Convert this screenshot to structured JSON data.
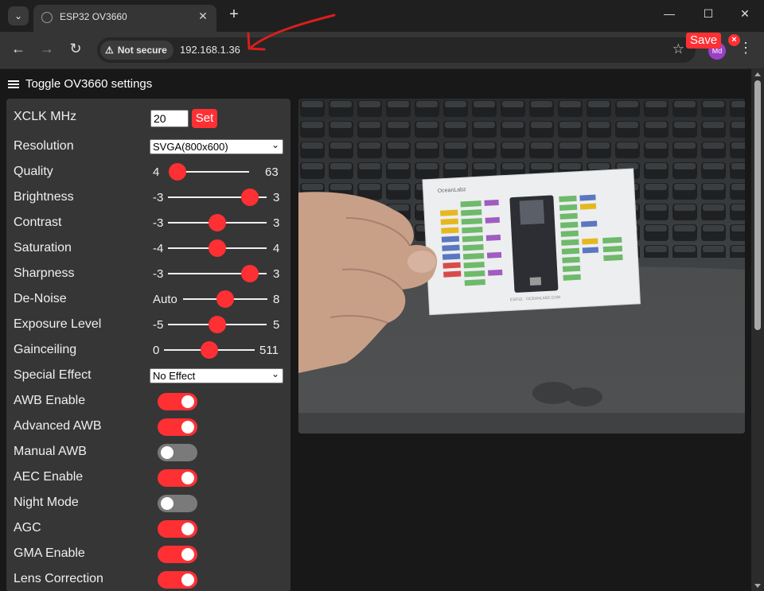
{
  "browser": {
    "tab_title": "ESP32 OV3660",
    "tab_close": "✕",
    "new_tab": "+",
    "security_label": "Not secure",
    "url": "192.168.1.36",
    "profile_initials": "Md"
  },
  "page": {
    "toggle_label": "Toggle OV3660 settings",
    "xclk": {
      "label": "XCLK MHz",
      "value": "20",
      "button": "Set"
    },
    "resolution": {
      "label": "Resolution",
      "selected": "SVGA(800x600)"
    },
    "special_effect": {
      "label": "Special Effect",
      "selected": "No Effect"
    },
    "sliders": [
      {
        "label": "Quality",
        "min": "4",
        "max": "63",
        "value": 10
      },
      {
        "label": "Brightness",
        "min": "-3",
        "max": "3",
        "value": 2
      },
      {
        "label": "Contrast",
        "min": "-3",
        "max": "3",
        "value": 0
      },
      {
        "label": "Saturation",
        "min": "-4",
        "max": "4",
        "value": 0
      },
      {
        "label": "Sharpness",
        "min": "-3",
        "max": "3",
        "value": 2
      },
      {
        "label": "De-Noise",
        "min": "Auto",
        "max": "8",
        "value": 4
      },
      {
        "label": "Exposure Level",
        "min": "-5",
        "max": "5",
        "value": 0
      },
      {
        "label": "Gainceiling",
        "min": "0",
        "max": "511",
        "value": 255
      }
    ],
    "toggles": [
      {
        "label": "AWB Enable",
        "on": true
      },
      {
        "label": "Advanced AWB",
        "on": true
      },
      {
        "label": "Manual AWB",
        "on": false
      },
      {
        "label": "AEC Enable",
        "on": true
      },
      {
        "label": "Night Mode",
        "on": false
      },
      {
        "label": "AGC",
        "on": true
      },
      {
        "label": "GMA Enable",
        "on": true
      },
      {
        "label": "Lens Correction",
        "on": true
      }
    ],
    "viewer": {
      "save_label": "Save",
      "close_label": "×",
      "board_brand": "OceanLabz",
      "board_caption": "ESP32 · OCEANLABZ.COM"
    }
  },
  "colors": {
    "accent": "#ff3034",
    "panel": "#363636",
    "page_bg": "#181818"
  }
}
